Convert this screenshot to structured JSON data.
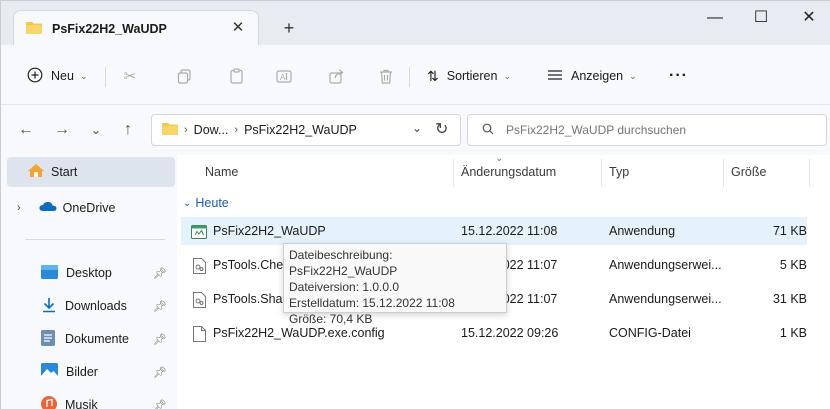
{
  "tab": {
    "title": "PsFix22H2_WaUDP",
    "close_glyph": "✕",
    "new_tab_glyph": "+"
  },
  "window_controls": {
    "minimize": "—",
    "maximize": "☐",
    "close": "✕"
  },
  "toolbar": {
    "new_label": "Neu",
    "sort_label": "Sortieren",
    "view_label": "Anzeigen",
    "more_label": "···"
  },
  "nav": {
    "back": "←",
    "forward": "→",
    "recent": "⌄",
    "up": "↑"
  },
  "address": {
    "crumbs": [
      "Dow...",
      "PsFix22H2_WaUDP"
    ],
    "crumb_separator": "›"
  },
  "search": {
    "placeholder": "PsFix22H2_WaUDP durchsuchen"
  },
  "sidebar": {
    "items": [
      {
        "label": "Start",
        "icon": "home-icon"
      },
      {
        "label": "OneDrive",
        "icon": "cloud-icon"
      },
      {
        "label": "Desktop",
        "icon": "desktop-icon"
      },
      {
        "label": "Downloads",
        "icon": "download-icon"
      },
      {
        "label": "Dokumente",
        "icon": "document-icon"
      },
      {
        "label": "Bilder",
        "icon": "pictures-icon"
      },
      {
        "label": "Musik",
        "icon": "music-icon"
      }
    ]
  },
  "columns": {
    "name": "Name",
    "date": "Änderungsdatum",
    "type": "Typ",
    "size": "Größe"
  },
  "group": {
    "label": "Heute"
  },
  "files": [
    {
      "name": "PsFix22H2_WaUDP",
      "date": "15.12.2022 11:08",
      "type": "Anwendung",
      "size": "71 KB"
    },
    {
      "name": "PsTools.Chec",
      "date": "15.12.2022 11:07",
      "type": "Anwendungserwei...",
      "size": "5 KB"
    },
    {
      "name": "PsTools.Share",
      "date": "15.12.2022 11:07",
      "type": "Anwendungserwei...",
      "size": "31 KB"
    },
    {
      "name": "PsFix22H2_WaUDP.exe.config",
      "date": "15.12.2022 09:26",
      "type": "CONFIG-Datei",
      "size": "1 KB"
    }
  ],
  "tooltip": {
    "line1": "Dateibeschreibung: PsFix22H2_WaUDP",
    "line2": "Dateiversion: 1.0.0.0",
    "line3": "Erstelldatum: 15.12.2022 11:08",
    "line4": "Größe: 70,4 KB"
  },
  "colors": {
    "accent": "#1a5fb4",
    "folder": "#f2c94c",
    "hover_row": "#e5f1fb",
    "selected_sidebar": "#dde4ee"
  }
}
